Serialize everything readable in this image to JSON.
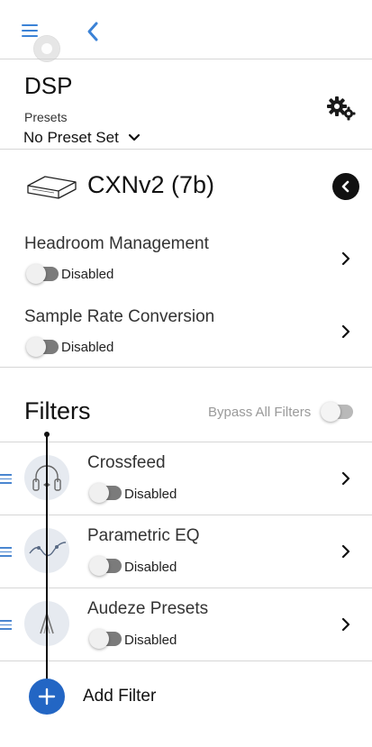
{
  "app": {
    "accent_color": "#3b82d6",
    "icons": {
      "menu": "hamburger-icon",
      "back": "chevron-left-icon",
      "settings": "gears-icon"
    }
  },
  "dsp": {
    "title": "DSP",
    "presets_label": "Presets",
    "preset_value": "No Preset Set"
  },
  "device": {
    "name": "CXNv2 (7b)",
    "settings": [
      {
        "title": "Headroom Management",
        "state": "Disabled"
      },
      {
        "title": "Sample Rate Conversion",
        "state": "Disabled"
      }
    ]
  },
  "filters": {
    "title": "Filters",
    "bypass_label": "Bypass All Filters",
    "items": [
      {
        "name": "Crossfeed",
        "state": "Disabled",
        "icon": "headphones-icon"
      },
      {
        "name": "Parametric EQ",
        "state": "Disabled",
        "icon": "eq-curve-icon"
      },
      {
        "name": "Audeze Presets",
        "state": "Disabled",
        "icon": "audeze-logo-icon"
      }
    ],
    "add_label": "Add Filter",
    "add_color": "#2366c4"
  }
}
